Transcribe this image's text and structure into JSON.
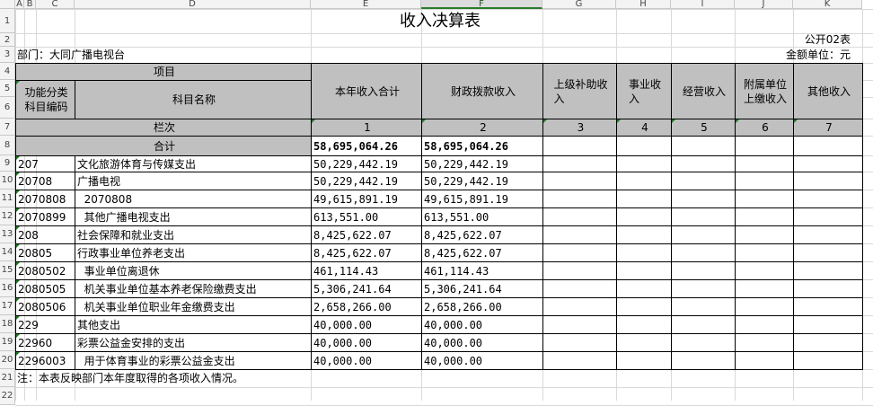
{
  "columns": [
    "A",
    "B",
    "C",
    "D",
    "E",
    "F",
    "G",
    "H",
    "I",
    "J",
    "K"
  ],
  "rows_nums": [
    "1",
    "2",
    "3",
    "4",
    "5",
    "6",
    "7",
    "8",
    "9",
    "10",
    "11",
    "12",
    "13",
    "14",
    "15",
    "16",
    "17",
    "18",
    "19",
    "20",
    "21",
    "22"
  ],
  "title": "收入决算表",
  "form_no": "公开02表",
  "dept": "部门：大同广播电视台",
  "unit": "金额单位：元",
  "headers": {
    "item": "项目",
    "code": "功能分类\n科目编码",
    "name": "科目名称",
    "total": "本年收入合计",
    "fiscal": "财政拨款收入",
    "subsidy": "上级补助收\n入",
    "business": "事业收\n入",
    "operating": "经营收入",
    "affiliated": "附属单位\n上缴收入",
    "other": "其他收入"
  },
  "lanci": "栏次",
  "col_numbers": [
    "1",
    "2",
    "3",
    "4",
    "5",
    "6",
    "7"
  ],
  "total_row": {
    "label": "合计",
    "total": "58,695,064.26",
    "fiscal": "58,695,064.26"
  },
  "rows": [
    {
      "code": "207",
      "name": "文化旅游体育与传媒支出",
      "total": "50,229,442.19",
      "fiscal": "50,229,442.19"
    },
    {
      "code": "20708",
      "name": "广播电视",
      "total": "50,229,442.19",
      "fiscal": "50,229,442.19"
    },
    {
      "code": "2070808",
      "name": "  2070808",
      "total": "49,615,891.19",
      "fiscal": "49,615,891.19"
    },
    {
      "code": "2070899",
      "name": "  其他广播电视支出",
      "total": "613,551.00",
      "fiscal": "613,551.00"
    },
    {
      "code": "208",
      "name": "社会保障和就业支出",
      "total": "8,425,622.07",
      "fiscal": "8,425,622.07"
    },
    {
      "code": "20805",
      "name": "行政事业单位养老支出",
      "total": "8,425,622.07",
      "fiscal": "8,425,622.07"
    },
    {
      "code": "2080502",
      "name": "  事业单位离退休",
      "total": "461,114.43",
      "fiscal": "461,114.43"
    },
    {
      "code": "2080505",
      "name": "  机关事业单位基本养老保险缴费支出",
      "total": "5,306,241.64",
      "fiscal": "5,306,241.64"
    },
    {
      "code": "2080506",
      "name": "  机关事业单位职业年金缴费支出",
      "total": "2,658,266.00",
      "fiscal": "2,658,266.00"
    },
    {
      "code": "229",
      "name": "其他支出",
      "total": "40,000.00",
      "fiscal": "40,000.00"
    },
    {
      "code": "22960",
      "name": "彩票公益金安排的支出",
      "total": "40,000.00",
      "fiscal": "40,000.00"
    },
    {
      "code": "2296003",
      "name": "  用于体育事业的彩票公益金支出",
      "total": "40,000.00",
      "fiscal": "40,000.00"
    }
  ],
  "note": "注：本表反映部门本年度取得的各项收入情况。"
}
